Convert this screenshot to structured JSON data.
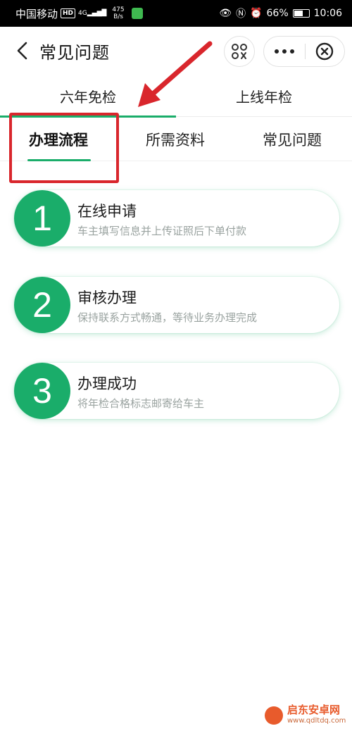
{
  "status_bar": {
    "carrier": "中国移动",
    "hd": "HD",
    "signal": "4G",
    "net_speed": "475",
    "net_unit": "B/s",
    "battery": "66%",
    "battery_level": 0.66,
    "time": "10:06"
  },
  "nav": {
    "title": "常见问题"
  },
  "top_tabs": [
    {
      "label": "六年免检",
      "active": true
    },
    {
      "label": "上线年检",
      "active": false
    }
  ],
  "sub_tabs": [
    {
      "label": "办理流程",
      "active": true
    },
    {
      "label": "所需资料",
      "active": false
    },
    {
      "label": "常见问题",
      "active": false
    }
  ],
  "steps": [
    {
      "number": "1",
      "title": "在线申请",
      "desc": "车主填写信息并上传证照后下单付款"
    },
    {
      "number": "2",
      "title": "审核办理",
      "desc": "保持联系方式畅通，等待业务办理完成"
    },
    {
      "number": "3",
      "title": "办理成功",
      "desc": "将年检合格标志邮寄给车主"
    }
  ],
  "watermark": {
    "name": "启东安卓网",
    "url": "www.qdltdq.com"
  },
  "colors": {
    "accent": "#1aad6a",
    "annotation": "#d9262c"
  }
}
